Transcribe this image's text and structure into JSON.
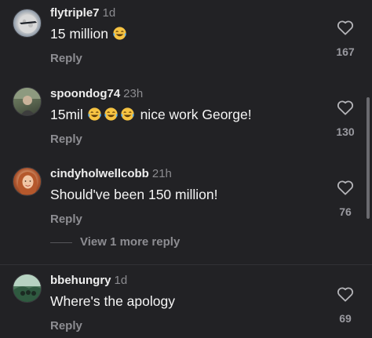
{
  "colors": {
    "background": "#222225",
    "username": "#eeeeee",
    "timestamp": "#8c8c90",
    "reply": "#8d8d92",
    "count": "#9a9aa0"
  },
  "comments": [
    {
      "username": "flytriple7",
      "time": "1d",
      "text": "15 million",
      "emoji": [
        "laughing-tears"
      ],
      "reply_label": "Reply",
      "like_icon": "heart-outline-icon",
      "likes": "167",
      "avatar": "moon-photo"
    },
    {
      "username": "spoondog74",
      "time": "23h",
      "text_before": "15mil",
      "emoji": [
        "laughing-tears",
        "laughing-tears",
        "laughing-tears"
      ],
      "text_after": "nice work George!",
      "reply_label": "Reply",
      "like_icon": "heart-outline-icon",
      "likes": "130",
      "avatar": "person-photo"
    },
    {
      "username": "cindyholwellcobb",
      "time": "21h",
      "text": "Should've been 150 million!",
      "reply_label": "Reply",
      "like_icon": "heart-outline-icon",
      "likes": "76",
      "avatar": "woman-portrait"
    },
    {
      "username": "bbehungry",
      "time": "1d",
      "text": "Where's the apology",
      "reply_label": "Reply",
      "like_icon": "heart-outline-icon",
      "likes": "69",
      "avatar": "forest-photo"
    }
  ],
  "view_more_replies": "View 1 more reply"
}
